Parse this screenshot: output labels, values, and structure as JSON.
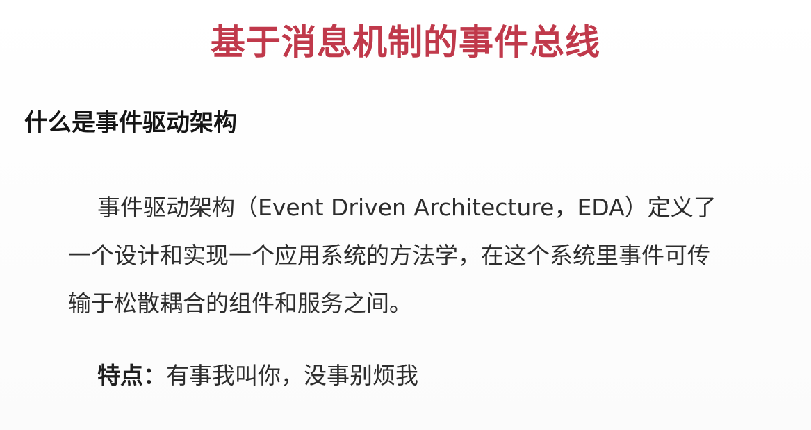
{
  "slide": {
    "title": "基于消息机制的事件总线",
    "section_heading": "什么是事件驱动架构",
    "paragraph_lines": [
      "事件驱动架构（Event Driven Architecture，EDA）定义了",
      "一个设计和实现一个应用系统的方法学，在这个系统里事件可传",
      "输于松散耦合的组件和服务之间。"
    ],
    "feature_label": "特点：",
    "feature_text": "有事我叫你，没事别烦我"
  },
  "colors": {
    "title": "#c0394b",
    "heading": "#151515",
    "body": "#2d2d2d",
    "background": "#ffffff"
  }
}
